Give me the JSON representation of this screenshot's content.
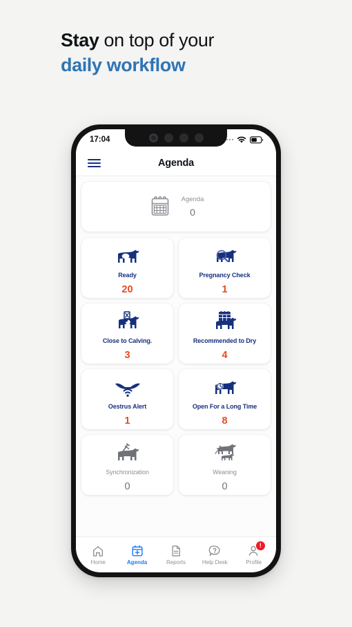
{
  "headline": {
    "line1_bold": "Stay",
    "line1_rest": " on top of your",
    "line2": "daily workflow",
    "accent_color": "#2f74b5"
  },
  "phone": {
    "status_bar": {
      "time": "17:04",
      "signal_icon": "signal-dots-icon",
      "wifi_icon": "wifi-icon",
      "battery_icon": "battery-icon"
    },
    "app_bar": {
      "menu_icon": "hamburger-menu-icon",
      "title": "Agenda"
    },
    "agenda_card": {
      "icon": "calendar-icon",
      "label": "Agenda",
      "value": "0"
    },
    "tiles": [
      {
        "label": "Ready",
        "value": "20",
        "icon": "cow-icon",
        "muted": false
      },
      {
        "label": "Pregnancy Check",
        "value": "1",
        "icon": "cow-magnifier-icon",
        "muted": false
      },
      {
        "label": "Close to Calving.",
        "value": "3",
        "icon": "cow-hourglass-icon",
        "muted": false
      },
      {
        "label": "Recommended to Dry",
        "value": "4",
        "icon": "cow-calendar-icon",
        "muted": false
      },
      {
        "label": "Oestrus Alert",
        "value": "1",
        "icon": "horns-signal-icon",
        "muted": false
      },
      {
        "label": "Open For a Long Time",
        "value": "8",
        "icon": "cow-clock-icon",
        "muted": false
      },
      {
        "label": "Synchronization",
        "value": "0",
        "icon": "cow-syringe-icon",
        "muted": true
      },
      {
        "label": "Weaning",
        "value": "0",
        "icon": "cow-calf-icon",
        "muted": true
      }
    ],
    "bottom_nav": [
      {
        "label": "Home",
        "icon": "home-icon",
        "active": false,
        "badge": ""
      },
      {
        "label": "Agenda",
        "icon": "calendar-plus-icon",
        "active": true,
        "badge": ""
      },
      {
        "label": "Reports",
        "icon": "document-icon",
        "active": false,
        "badge": ""
      },
      {
        "label": "Help Desk",
        "icon": "question-bubble-icon",
        "active": false,
        "badge": ""
      },
      {
        "label": "Profile",
        "icon": "person-icon",
        "active": false,
        "badge": "!"
      }
    ]
  },
  "colors": {
    "navy": "#17307d",
    "orange": "#e8491e",
    "blue_active": "#1d7df0",
    "grey": "#8d9095",
    "badge_red": "#ed1b24"
  }
}
